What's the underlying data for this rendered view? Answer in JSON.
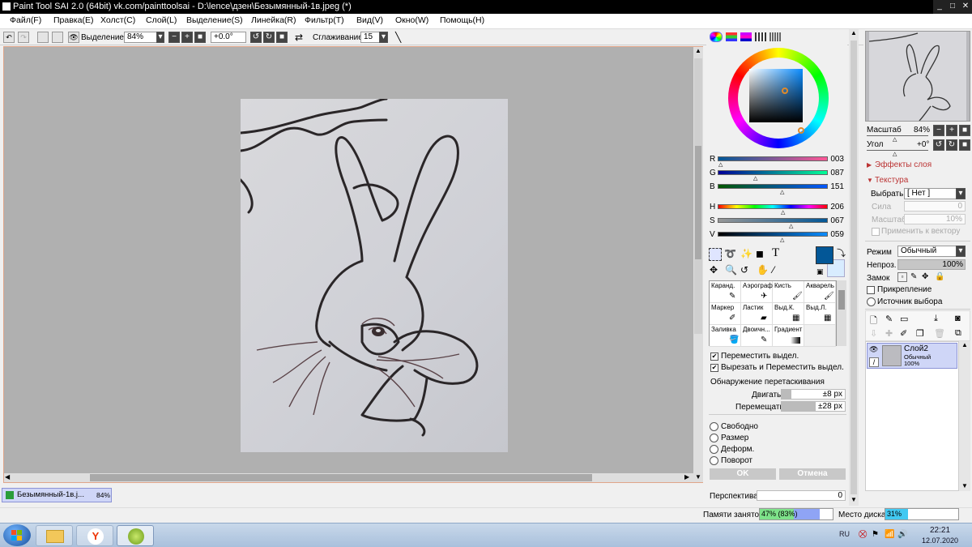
{
  "title": "Paint Tool SAI 2.0 (64bit) vk.com/painttoolsai - D:\\lence\\дзен\\Безымянный-1в.jpeg (*)",
  "menu": [
    "Файл(F)",
    "Правка(E)",
    "Холст(C)",
    "Слой(L)",
    "Выделение(S)",
    "Линейка(R)",
    "Фильтр(T)",
    "Вид(V)",
    "Окно(W)",
    "Помощь(H)"
  ],
  "toolbar": {
    "selection_label": "Выделение",
    "zoom": "84%",
    "angle": "+0.0°",
    "smoothing_label": "Сглаживание",
    "smoothing_value": "15"
  },
  "document_tab": {
    "name": "Безымянный-1в.j...",
    "zoom": "84%"
  },
  "color": {
    "r": "003",
    "g": "087",
    "b": "151",
    "h": "206",
    "s": "067",
    "v": "059",
    "fg": "#035797",
    "bg": "#d8ecff"
  },
  "tools": [
    [
      "Каранд.",
      "Аэрограф",
      "Кисть",
      "Акварель"
    ],
    [
      "Маркер",
      "Ластик",
      "Выд.К.",
      "Выд.Л."
    ],
    [
      "Заливка",
      "Двоичн...",
      "Градиент",
      ""
    ]
  ],
  "transform": {
    "move_sel": "Переместить выдел.",
    "cut_move_sel": "Вырезать и Переместить выдел.",
    "drag_detect": "Обнаружение перетаскивания",
    "move_label": "Двигать",
    "move_val": "±8 px",
    "shift_label": "Перемещать",
    "shift_val": "±28 px",
    "free": "Свободно",
    "size": "Размер",
    "deform": "Деформ.",
    "rotate": "Поворот",
    "ok": "OK",
    "cancel": "Отмена",
    "perspective": "Перспектива",
    "perspective_val": "0"
  },
  "navigator": {
    "scale_label": "Масштаб",
    "scale_val": "84%",
    "angle_label": "Угол",
    "angle_val": "+0°"
  },
  "layer_props": {
    "effects": "Эффекты слоя",
    "texture": "Текстура",
    "choose_label": "Выбрать",
    "choose_val": "[ Нет ]",
    "strength_label": "Сила",
    "strength_val": "0",
    "scale_label": "Масштаб",
    "scale_val": "10%",
    "apply_vector": "Применить к вектору",
    "mode_label": "Режим",
    "mode_val": "Обычный",
    "opacity_label": "Непроз.",
    "opacity_val": "100%",
    "lock_label": "Замок",
    "clip": "Прикрепление",
    "source": "Источник выбора"
  },
  "layer": {
    "name": "Слой2",
    "mode": "Обычный",
    "opacity": "100%"
  },
  "status": {
    "mem_label": "Памяти занято",
    "mem_val": "47% (83%)",
    "mem_fill": 0.47,
    "disk_label": "Место диска",
    "disk_val": "31%",
    "disk_fill": 0.31
  },
  "taskbar": {
    "lang": "RU",
    "time": "22:21",
    "date": "12.07.2020"
  }
}
